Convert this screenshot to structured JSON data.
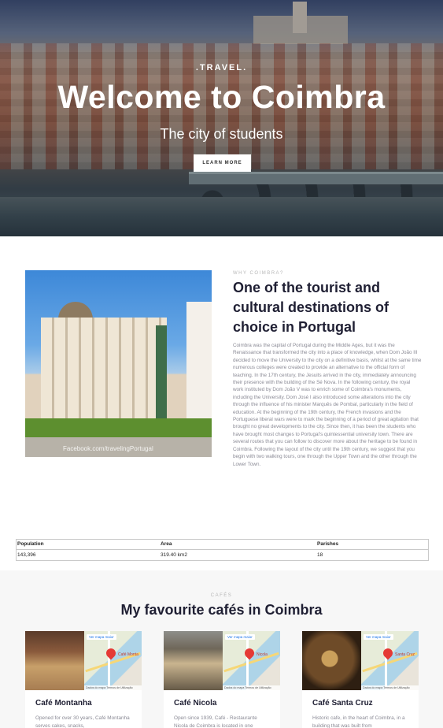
{
  "hero": {
    "kicker": ".TRAVEL.",
    "title": "Welcome to Coimbra",
    "subtitle": "The city of students",
    "button_label": "LEARN MORE"
  },
  "about": {
    "photo_watermark": "Facebook.com/travelingPortugal",
    "kicker": "WHY COIMBRA?",
    "title": "One of the tourist and cultural destinations of choice in Portugal",
    "text": "Coimbra was the capital of Portugal during the Middle Ages, but it was the Renaissance that transformed the city into a place of knowledge, when Dom João III decided to move the University to the city on a definitive basis, whilst at the same time numerous colleges were created to provide an alternative to the official form of teaching. In the 17th century, the Jesuits arrived in the city, immediately announcing their presence with the building of the Sé Nova. In the following century, the royal work instituted by Dom João V was to enrich some of Coimbra's monuments, including the University. Dom José I also introduced some alterations into the city through the influence of his minister Marquês de Pombal, particularly in the field of education. At the beginning of the 19th century, the French invasions and the Portuguese liberal wars were to mark the beginning of a period of great agitation that brought no great developments to the city. Since then, it has been the students who have brought most changes to Portugal's quintessential university town. There are several routes that you can follow to discover more about the heritage to be found in Coimbra. Following the layout of the city until the 19th century, we suggest that you begin with two walking tours, one through the Upper Town and the other through the Lower Town."
  },
  "stats": {
    "headers": [
      "Population",
      "Area",
      "Parishes"
    ],
    "values": [
      "143,396",
      "319.40 km2",
      "18"
    ]
  },
  "cafes": {
    "kicker": "CAFÉS",
    "title": "My favourite cafés in Coimbra",
    "items": [
      {
        "name": "Café Montanha",
        "desc": "Opened for over 30 years, Café Montanha serves cakes, snacks,",
        "map_link": "Ver mapa maior",
        "map_label": "Café Monta",
        "map_footer": "Dados do mapa  Termos de Utilização"
      },
      {
        "name": "Café Nicola",
        "desc": "Open since 1939, Café - Restaurante Nicola de Coimbra is located in one",
        "map_link": "Ver mapa maior",
        "map_label": "Nicola",
        "map_footer": "Dados do mapa  Termos de Utilização"
      },
      {
        "name": "Café Santa Cruz",
        "desc": "Historic cafe, in the heart of Coimbra, in a building that was built from",
        "map_link": "Ver mapa maior",
        "map_label": "Santa Cruz",
        "map_footer": "Dados do mapa  Termos de Utilização"
      }
    ]
  }
}
